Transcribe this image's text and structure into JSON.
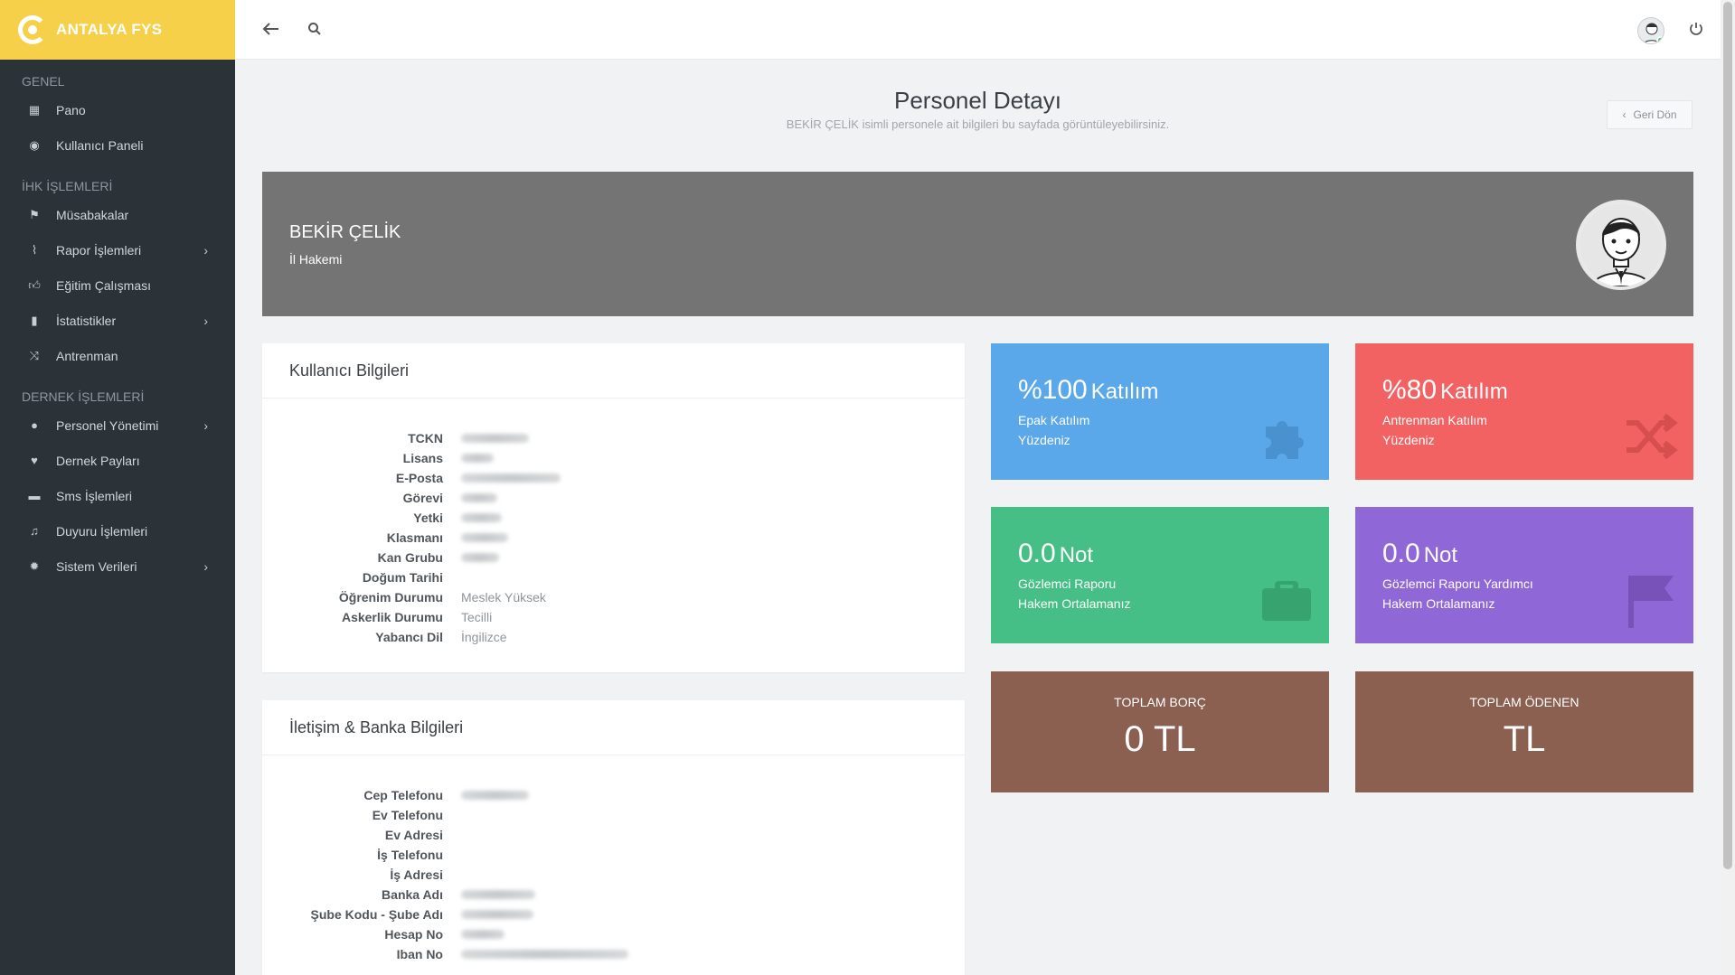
{
  "brand": {
    "name": "ANTALYA FYS"
  },
  "sidebar": {
    "sections": [
      {
        "title": "GENEL",
        "items": [
          {
            "label": "Pano",
            "icon": "table-icon",
            "has_children": false
          },
          {
            "label": "Kullanıcı Paneli",
            "icon": "user-circle-icon",
            "has_children": false
          }
        ]
      },
      {
        "title": "İHK İŞLEMLERİ",
        "items": [
          {
            "label": "Müsabakalar",
            "icon": "flag-icon",
            "has_children": false
          },
          {
            "label": "Rapor İşlemleri",
            "icon": "paperclip-icon",
            "has_children": true
          },
          {
            "label": "Eğitim Çalışması",
            "icon": "thumbs-up-icon",
            "has_children": false
          },
          {
            "label": "İstatistikler",
            "icon": "bar-chart-icon",
            "has_children": true
          },
          {
            "label": "Antrenman",
            "icon": "shuffle-icon",
            "has_children": false
          }
        ]
      },
      {
        "title": "DERNEK İŞLEMLERİ",
        "items": [
          {
            "label": "Personel Yönetimi",
            "icon": "user-icon",
            "has_children": true
          },
          {
            "label": "Dernek Payları",
            "icon": "heart-icon",
            "has_children": false
          },
          {
            "label": "Sms İşlemleri",
            "icon": "message-icon",
            "has_children": false
          },
          {
            "label": "Duyuru İşlemleri",
            "icon": "bell-icon",
            "has_children": false
          },
          {
            "label": "Sistem Verileri",
            "icon": "gear-icon",
            "has_children": true
          }
        ]
      }
    ]
  },
  "page": {
    "title": "Personel Detayı",
    "subtitle": "BEKİR ÇELİK isimli personele ait bilgileri bu sayfada görüntüleyebilirsiniz.",
    "back_label": "Geri Dön"
  },
  "profile": {
    "name": "BEKİR ÇELİK",
    "role": "İl Hakemi"
  },
  "user_info": {
    "title": "Kullanıcı Bilgileri",
    "rows": [
      {
        "label": "TCKN",
        "value": null,
        "redacted": true,
        "blur_w": 75
      },
      {
        "label": "Lisans",
        "value": null,
        "redacted": true,
        "blur_w": 36
      },
      {
        "label": "E-Posta",
        "value": null,
        "redacted": true,
        "blur_w": 110
      },
      {
        "label": "Görevi",
        "value": null,
        "redacted": true,
        "blur_w": 40
      },
      {
        "label": "Yetki",
        "value": null,
        "redacted": true,
        "blur_w": 45
      },
      {
        "label": "Klasmanı",
        "value": null,
        "redacted": true,
        "blur_w": 52
      },
      {
        "label": "Kan Grubu",
        "value": null,
        "redacted": true,
        "blur_w": 42
      },
      {
        "label": "Doğum Tarihi",
        "value": null,
        "redacted": false,
        "blur_w": 0
      },
      {
        "label": "Öğrenim Durumu",
        "value": "Meslek Yüksek",
        "redacted": false,
        "blur_w": 0
      },
      {
        "label": "Askerlik Durumu",
        "value": "Tecilli",
        "redacted": false,
        "blur_w": 0
      },
      {
        "label": "Yabancı Dil",
        "value": "İngilizce",
        "redacted": false,
        "blur_w": 0
      }
    ]
  },
  "contact_info": {
    "title": "İletişim & Banka Bilgileri",
    "rows": [
      {
        "label": "Cep Telefonu",
        "value": null,
        "redacted": true,
        "blur_w": 75
      },
      {
        "label": "Ev Telefonu",
        "value": null,
        "redacted": false,
        "blur_w": 0
      },
      {
        "label": "Ev Adresi",
        "value": null,
        "redacted": false,
        "blur_w": 0
      },
      {
        "label": "İş Telefonu",
        "value": null,
        "redacted": false,
        "blur_w": 0
      },
      {
        "label": "İş Adresi",
        "value": null,
        "redacted": false,
        "blur_w": 0
      },
      {
        "label": "Banka Adı",
        "value": null,
        "redacted": true,
        "blur_w": 82
      },
      {
        "label": "Şube Kodu - Şube Adı",
        "value": null,
        "redacted": true,
        "blur_w": 80
      },
      {
        "label": "Hesap No",
        "value": null,
        "redacted": true,
        "blur_w": 48
      },
      {
        "label": "Iban No",
        "value": null,
        "redacted": true,
        "blur_w": 185
      }
    ]
  },
  "tiles": {
    "epak": {
      "value": "%100",
      "unit": "Katılım",
      "line1": "Epak Katılım",
      "line2": "Yüzdeniz",
      "color": "#5aa8ea",
      "icon": "puzzle-icon"
    },
    "training": {
      "value": "%80",
      "unit": "Katılım",
      "line1": "Antrenman Katılım",
      "line2": "Yüzdeniz",
      "color": "#f36262",
      "icon": "shuffle-icon"
    },
    "observer": {
      "value": "0.0",
      "unit": "Not",
      "line1": "Gözlemci Raporu",
      "line2": "Hakem Ortalamanız",
      "color": "#45bf85",
      "icon": "briefcase-icon"
    },
    "observer_asst": {
      "value": "0.0",
      "unit": "Not",
      "line1": "Gözlemci Raporu Yardımcı",
      "line2": "Hakem Ortalamanız",
      "color": "#9067d6",
      "icon": "flag-icon"
    },
    "total_debt": {
      "label": "TOPLAM BORÇ",
      "amount": "0 TL",
      "color": "#8b6050"
    },
    "total_paid": {
      "label": "TOPLAM ÖDENEN",
      "amount": "TL",
      "color": "#8b6050"
    }
  }
}
